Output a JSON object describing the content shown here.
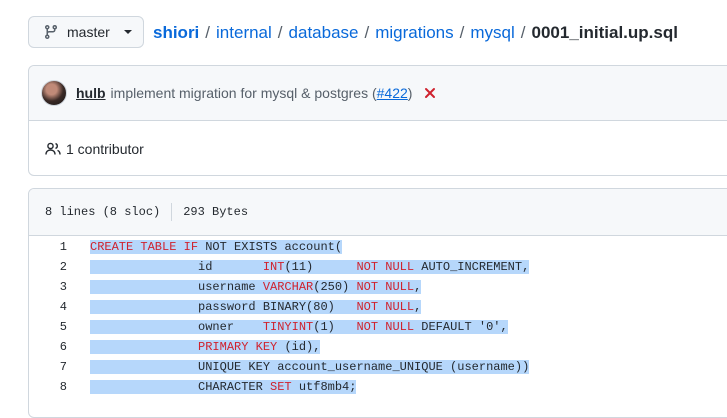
{
  "branch": {
    "name": "master"
  },
  "breadcrumb": {
    "repo": "shiori",
    "path": [
      "internal",
      "database",
      "migrations",
      "mysql"
    ],
    "file": "0001_initial.up.sql",
    "separator": "/"
  },
  "commit": {
    "author": "hulb",
    "message": "implement migration for mysql & postgres (",
    "pr_link": "#422",
    "message_end": ")",
    "status": "failed",
    "status_color": "#cf222e"
  },
  "contributors": {
    "label": "1 contributor"
  },
  "file_info": {
    "lines": "8 lines (8 sloc)",
    "size": "293 Bytes"
  },
  "code": {
    "line_numbers": [
      "1",
      "2",
      "3",
      "4",
      "5",
      "6",
      "7",
      "8"
    ],
    "lines": [
      [
        [
          "kw",
          "CREATE TABLE IF"
        ],
        [
          "pl",
          " NOT EXISTS account("
        ]
      ],
      [
        [
          "pl",
          "               id       "
        ],
        [
          "kw",
          "INT"
        ],
        [
          "pl",
          "(11)      "
        ],
        [
          "kw",
          "NOT NULL"
        ],
        [
          "pl",
          " AUTO_INCREMENT,"
        ]
      ],
      [
        [
          "pl",
          "               username "
        ],
        [
          "kw",
          "VARCHAR"
        ],
        [
          "pl",
          "(250) "
        ],
        [
          "kw",
          "NOT NULL"
        ],
        [
          "pl",
          ","
        ]
      ],
      [
        [
          "pl",
          "               password BINARY(80)   "
        ],
        [
          "kw",
          "NOT NULL"
        ],
        [
          "pl",
          ","
        ]
      ],
      [
        [
          "pl",
          "               owner    "
        ],
        [
          "kw",
          "TINYINT"
        ],
        [
          "pl",
          "(1)   "
        ],
        [
          "kw",
          "NOT NULL"
        ],
        [
          "pl",
          " DEFAULT '0',"
        ]
      ],
      [
        [
          "pl",
          "               "
        ],
        [
          "kw",
          "PRIMARY KEY"
        ],
        [
          "pl",
          " (id),"
        ]
      ],
      [
        [
          "pl",
          "               UNIQUE KEY account_username_UNIQUE (username))"
        ]
      ],
      [
        [
          "pl",
          "               CHARACTER "
        ],
        [
          "kw",
          "SET"
        ],
        [
          "pl",
          " utf8mb4;"
        ]
      ]
    ]
  },
  "colors": {
    "link": "#0969da",
    "keyword": "#cf222e",
    "selection": "#b6d7fb",
    "border": "#d0d7de"
  }
}
